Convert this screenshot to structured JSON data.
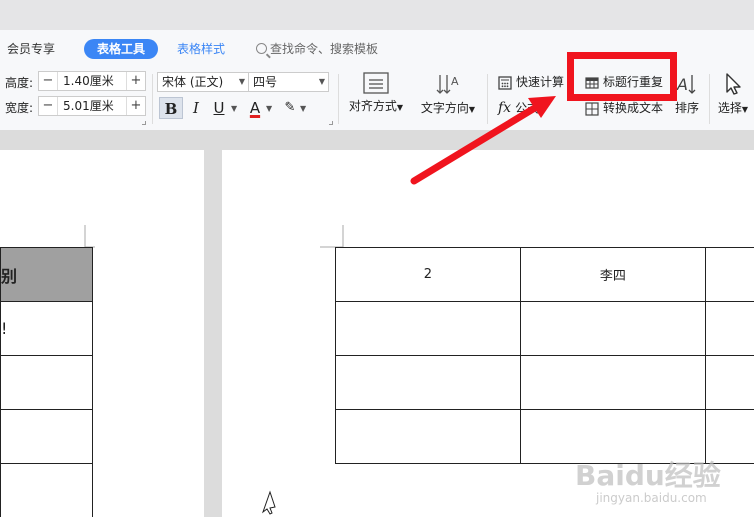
{
  "tabs": {
    "member": "会员专享",
    "table_tools": "表格工具",
    "table_style": "表格样式",
    "search": "查找命令、搜索模板"
  },
  "ribbon": {
    "height_label": "高度:",
    "height_value": "1.40厘米",
    "width_label": "宽度:",
    "width_value": "5.01厘米",
    "minus": "−",
    "plus": "+",
    "font_name": "宋体 (正文)",
    "font_size": "四号",
    "bold": "B",
    "italic": "I",
    "underline": "U",
    "font_color": "A",
    "highlight": "✎",
    "align_label": "对齐方式",
    "text_dir_label": "文字方向",
    "quick_calc": "快速计算",
    "formula": "公式",
    "title_repeat": "标题行重复",
    "convert_text": "转换成文本",
    "sort": "排序",
    "select": "选择"
  },
  "doc": {
    "left_table": [
      [
        "别"
      ],
      [
        "!"
      ],
      [
        ""
      ],
      [
        ""
      ],
      [
        ""
      ]
    ],
    "right_table": [
      [
        "2",
        "李四",
        ""
      ],
      [
        "",
        "",
        ""
      ],
      [
        "",
        "",
        ""
      ],
      [
        "",
        "",
        ""
      ]
    ]
  },
  "watermark": {
    "main": "Baidu经验",
    "sub": "jingyan.baidu.com"
  },
  "colors": {
    "accent": "#3b86f5",
    "highlight_box": "#f0141e",
    "header_fill": "#a0a0a0"
  }
}
